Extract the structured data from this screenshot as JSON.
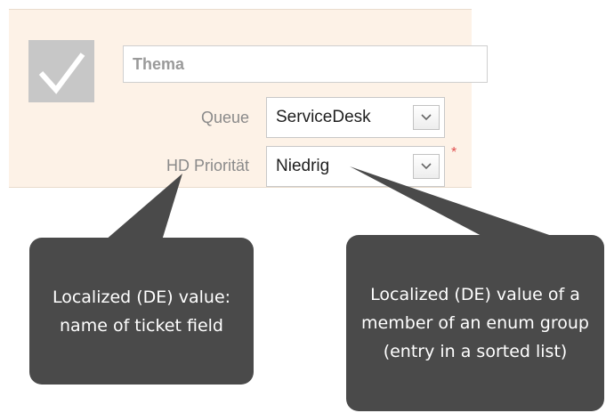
{
  "form": {
    "status_icon": "checkmark-icon",
    "subject_placeholder": "Thema",
    "fields": {
      "queue": {
        "label": "Queue",
        "value": "ServiceDesk"
      },
      "priority": {
        "label": "HD Priorität",
        "value": "Niedrig",
        "required_marker": "*"
      }
    },
    "dropdown_icon": "chevron-down-icon"
  },
  "callouts": {
    "left": "Localized (DE) value: name of ticket field",
    "right": "Localized (DE) value of a member of an enum group (entry in a sorted list)"
  },
  "colors": {
    "panel_background": "#fdf2e7",
    "callout_background": "#4a4a4a",
    "required": "#e05050",
    "check_tile": "#c7c7c7"
  }
}
